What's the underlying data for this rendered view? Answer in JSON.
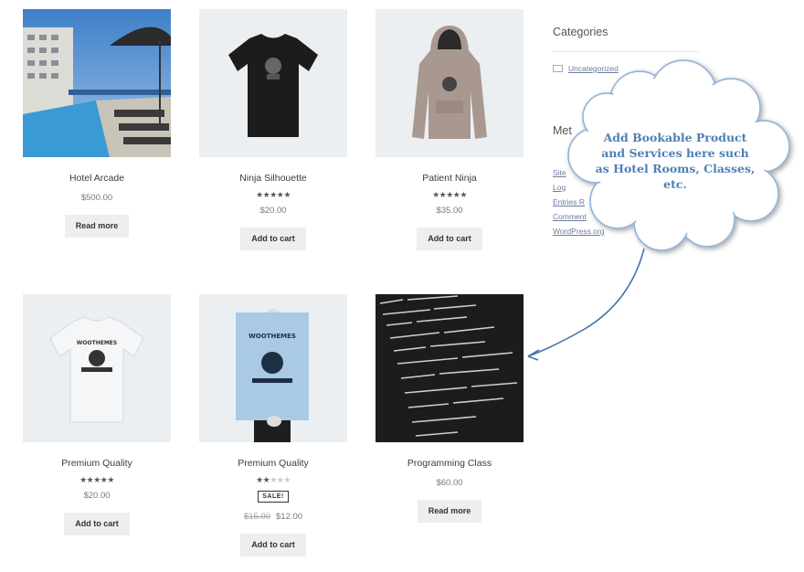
{
  "products": [
    {
      "title": "Hotel Arcade",
      "price": "$500.00",
      "button": "Read more",
      "rating": null
    },
    {
      "title": "Ninja Silhouette",
      "price": "$20.00",
      "button": "Add to cart",
      "rating": 5
    },
    {
      "title": "Patient Ninja",
      "price": "$35.00",
      "button": "Add to cart",
      "rating": 4.5
    },
    {
      "title": "Premium Quality",
      "price": "$20.00",
      "button": "Add to cart",
      "rating": 4.5
    },
    {
      "title": "Premium Quality",
      "old_price": "$15.00",
      "price": "$12.00",
      "button": "Add to cart",
      "rating": 2,
      "badge": "SALE!"
    },
    {
      "title": "Programming Class",
      "price": "$60.00",
      "button": "Read more",
      "rating": null
    }
  ],
  "images": {
    "tshirt_text": "WOOTHEMES",
    "poster_text": "WOOTHEMES"
  },
  "sidebar": {
    "categories_title": "Categories",
    "category_item": "Uncategorized",
    "meta_title_partial": "Met",
    "meta_links": [
      "Site",
      "Log",
      "Entries R",
      "Comment",
      "WordPress.org"
    ]
  },
  "callout": {
    "line1": "Add Bookable Product",
    "line2": "and Services here such",
    "line3": "as Hotel Rooms, Classes,",
    "line4": "etc."
  },
  "colors": {
    "callout_text": "#4f7fb5",
    "callout_fill": "#ffffff",
    "arrow": "#4a73a8",
    "link": "#6b7d99"
  }
}
